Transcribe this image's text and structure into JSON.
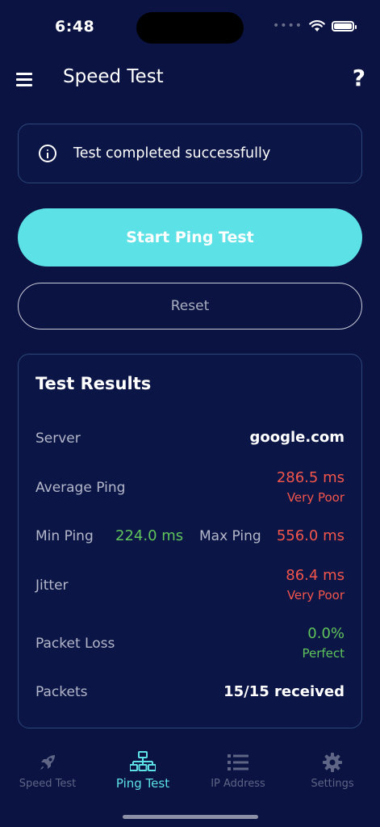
{
  "status_bar": {
    "time": "6:48"
  },
  "header": {
    "title": "Speed Test",
    "help_label": "?"
  },
  "banner": {
    "message": "Test completed successfully"
  },
  "actions": {
    "start_label": "Start Ping Test",
    "reset_label": "Reset"
  },
  "results": {
    "title": "Test Results",
    "server_label": "Server",
    "server_value": "google.com",
    "avg_label": "Average Ping",
    "avg_value": "286.5 ms",
    "avg_quality": "Very Poor",
    "min_label": "Min Ping",
    "min_value": "224.0 ms",
    "max_label": "Max Ping",
    "max_value": "556.0 ms",
    "jitter_label": "Jitter",
    "jitter_value": "86.4 ms",
    "jitter_quality": "Very Poor",
    "loss_label": "Packet Loss",
    "loss_value": "0.0%",
    "loss_quality": "Perfect",
    "packets_label": "Packets",
    "packets_value": "15/15 received"
  },
  "nav": {
    "items": [
      {
        "label": "Speed Test",
        "icon": "rocket-icon"
      },
      {
        "label": "Ping Test",
        "icon": "network-icon"
      },
      {
        "label": "IP Address",
        "icon": "list-icon"
      },
      {
        "label": "Settings",
        "icon": "gear-icon"
      }
    ],
    "active_index": 1
  },
  "colors": {
    "background": "#0b1342",
    "accent": "#5ce1e6",
    "bad": "#f2554b",
    "good": "#5fc45b",
    "card_border": "#2b4679"
  }
}
